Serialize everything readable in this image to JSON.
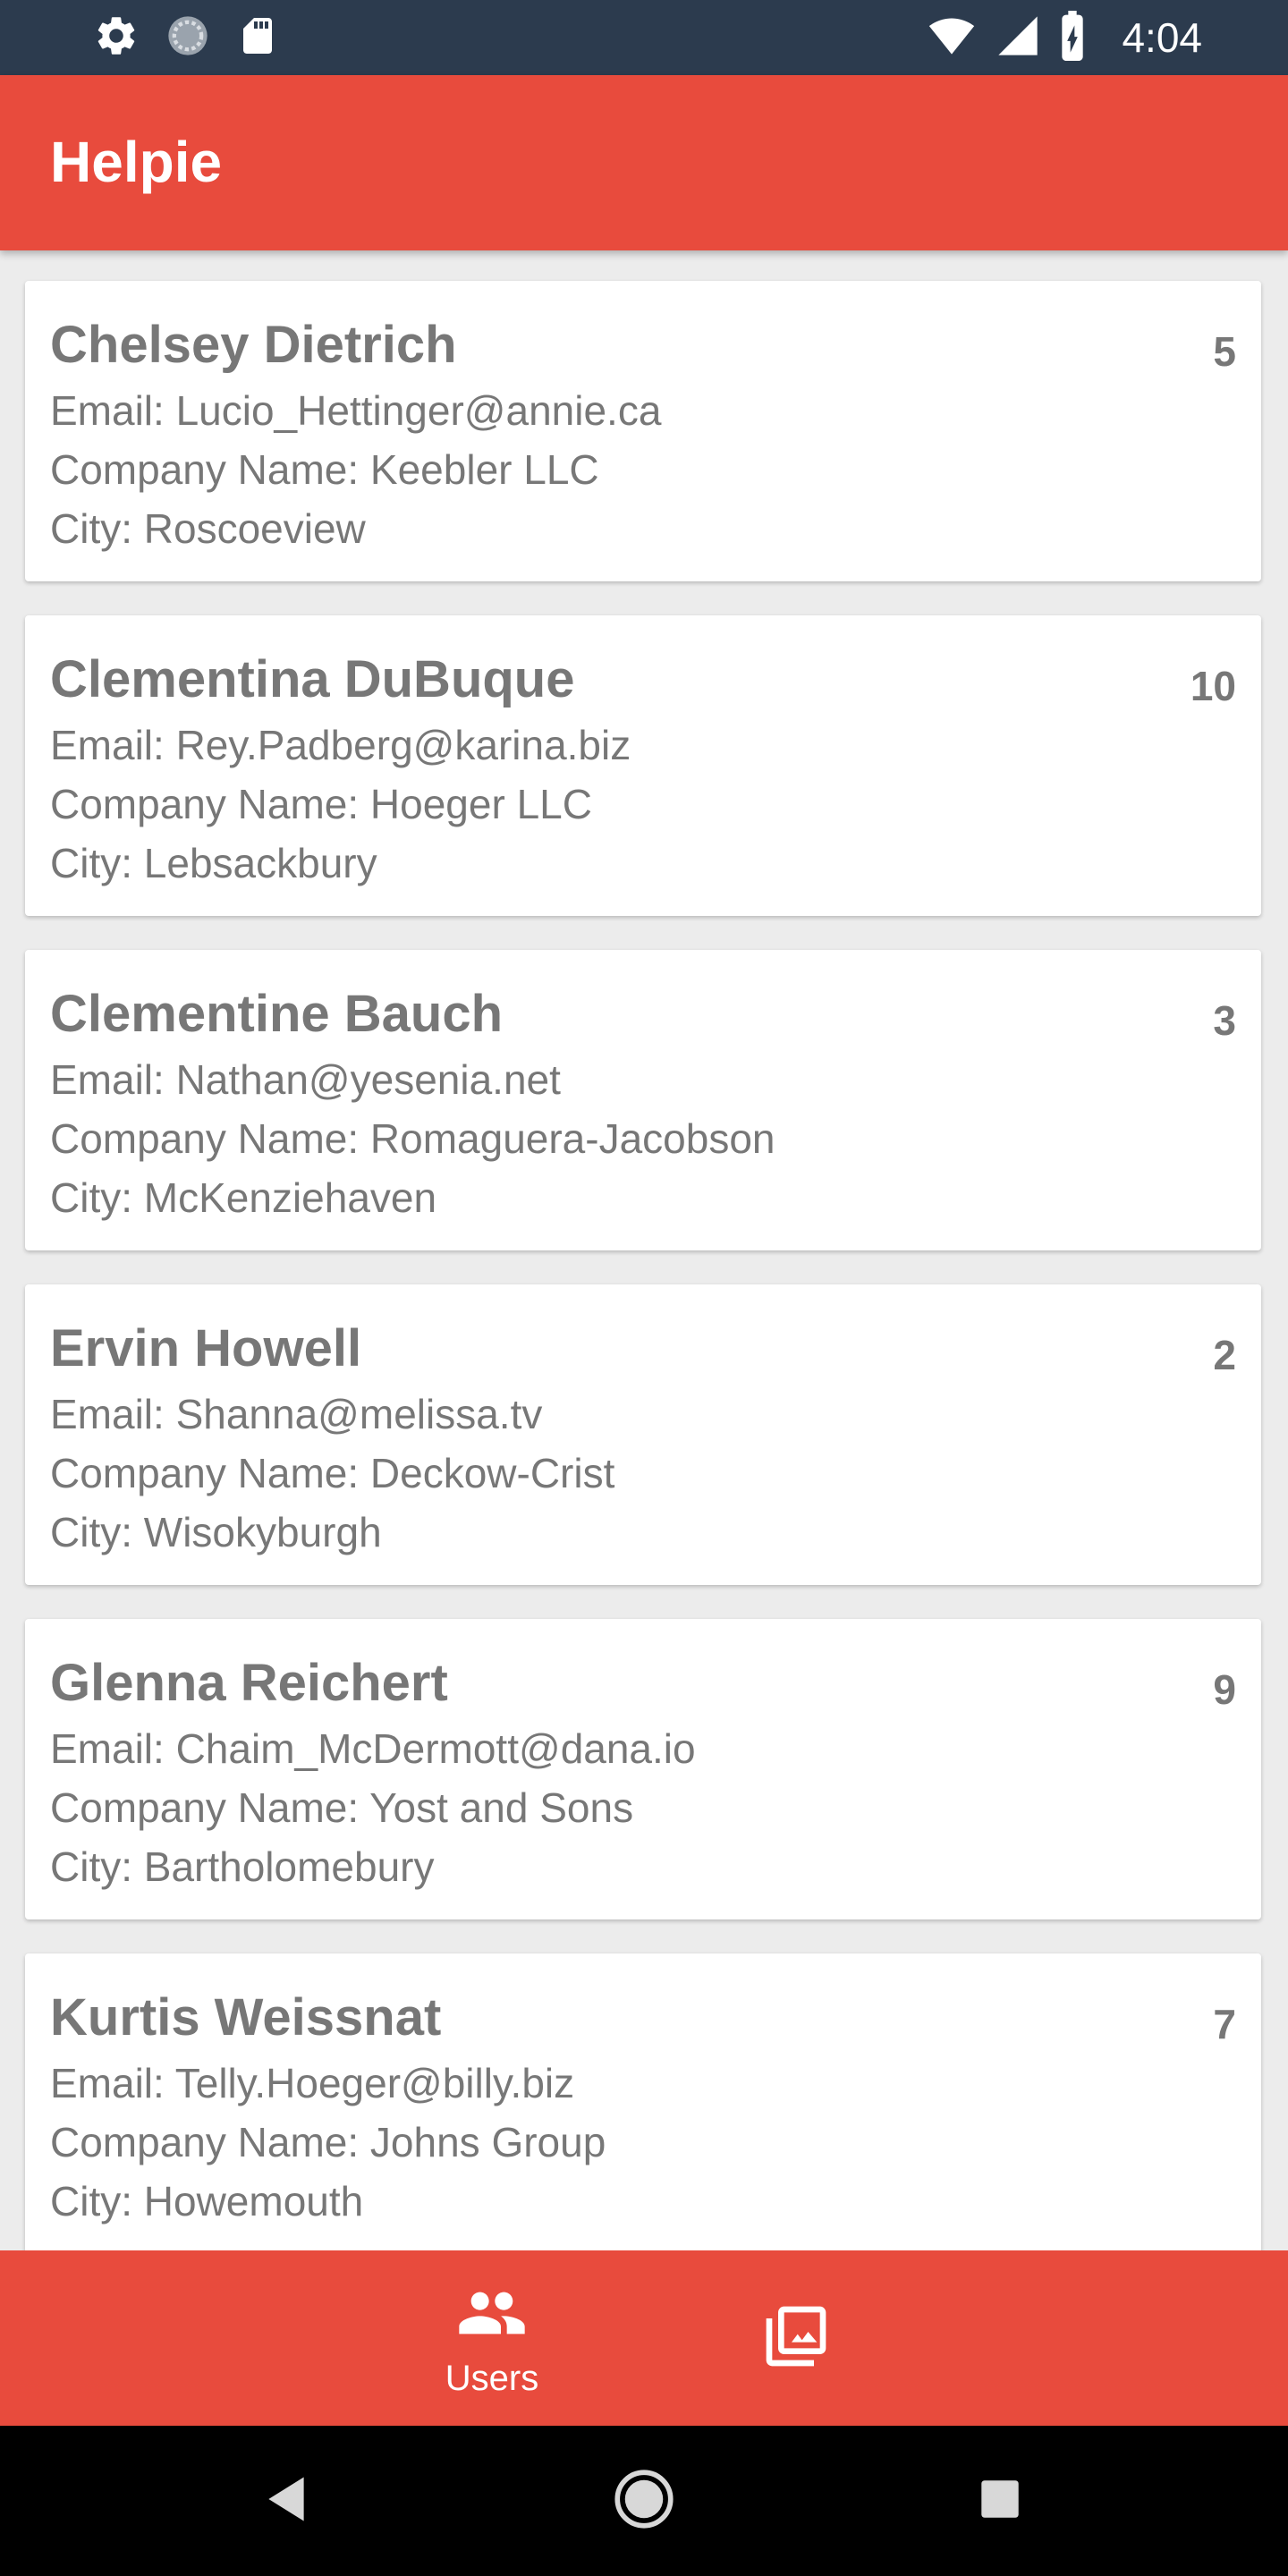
{
  "status_bar": {
    "time": "4:04",
    "left_icons": [
      "settings-icon",
      "sync-icon",
      "sd-card-icon"
    ],
    "right_icons": [
      "wifi-icon",
      "signal-icon",
      "battery-charging-icon"
    ]
  },
  "app_bar": {
    "title": "Helpie",
    "color": "#e84b3d"
  },
  "users": [
    {
      "name": "Chelsey Dietrich",
      "count": "5",
      "email": "Email: Lucio_Hettinger@annie.ca",
      "company": "Company Name: Keebler LLC",
      "city": "City: Roscoeview"
    },
    {
      "name": "Clementina DuBuque",
      "count": "10",
      "email": "Email: Rey.Padberg@karina.biz",
      "company": "Company Name: Hoeger LLC",
      "city": "City: Lebsackbury"
    },
    {
      "name": "Clementine Bauch",
      "count": "3",
      "email": "Email: Nathan@yesenia.net",
      "company": "Company Name: Romaguera-Jacobson",
      "city": "City: McKenziehaven"
    },
    {
      "name": "Ervin Howell",
      "count": "2",
      "email": "Email: Shanna@melissa.tv",
      "company": "Company Name: Deckow-Crist",
      "city": "City: Wisokyburgh"
    },
    {
      "name": "Glenna Reichert",
      "count": "9",
      "email": "Email: Chaim_McDermott@dana.io",
      "company": "Company Name: Yost and Sons",
      "city": "City: Bartholomebury"
    },
    {
      "name": "Kurtis Weissnat",
      "count": "7",
      "email": "Email: Telly.Hoeger@billy.biz",
      "company": "Company Name: Johns Group",
      "city": "City: Howemouth"
    }
  ],
  "bottom_nav": {
    "items": [
      {
        "label": "Users",
        "icon": "users-icon"
      },
      {
        "label": "",
        "icon": "photo-library-icon"
      }
    ],
    "active_color": "#ffffff"
  },
  "system_nav": {
    "icons": [
      "back-icon",
      "home-icon",
      "recents-icon"
    ]
  }
}
